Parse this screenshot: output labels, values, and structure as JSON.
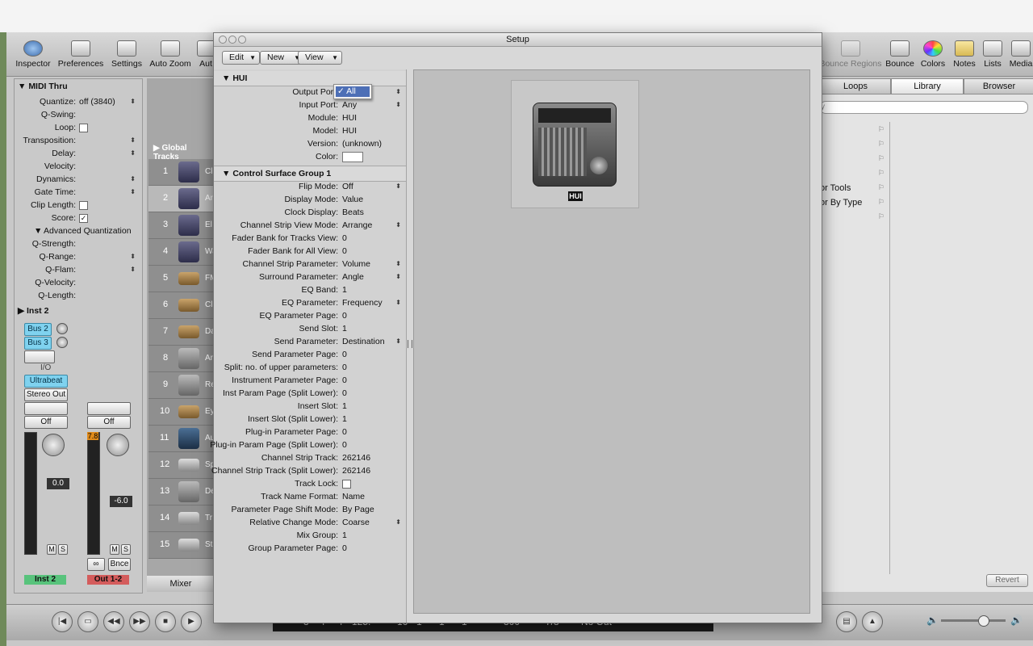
{
  "toolbar": {
    "items": [
      {
        "label": "Inspector"
      },
      {
        "label": "Preferences"
      },
      {
        "label": "Settings"
      },
      {
        "label": "Auto Zoom"
      },
      {
        "label": "Aut"
      },
      {
        "label": "Bounce Regions"
      },
      {
        "label": "Bounce"
      },
      {
        "label": "Colors"
      },
      {
        "label": "Notes"
      },
      {
        "label": "Lists"
      },
      {
        "label": "Media"
      }
    ]
  },
  "inspector": {
    "region_header": "MIDI Thru",
    "rows": [
      {
        "label": "Quantize:",
        "value": "off (3840)"
      },
      {
        "label": "Q-Swing:",
        "value": ""
      },
      {
        "label": "Loop:",
        "value": ""
      },
      {
        "label": "Transposition:",
        "value": ""
      },
      {
        "label": "Delay:",
        "value": ""
      },
      {
        "label": "Velocity:",
        "value": ""
      },
      {
        "label": "Dynamics:",
        "value": ""
      },
      {
        "label": "Gate Time:",
        "value": ""
      },
      {
        "label": "Clip Length:",
        "value": ""
      },
      {
        "label": "Score:",
        "value": ""
      }
    ],
    "advanced_header": "Advanced Quantization",
    "adv_rows": [
      {
        "label": "Q-Strength:"
      },
      {
        "label": "Q-Range:"
      },
      {
        "label": "Q-Flam:"
      },
      {
        "label": "Q-Velocity:"
      },
      {
        "label": "Q-Length:"
      }
    ],
    "track_header": "Inst 2",
    "strip": {
      "sends": [
        "Bus 2",
        "Bus 3"
      ],
      "io_label": "I/O",
      "input": "Ultrabeat",
      "output": "Stereo Out",
      "auto_left": "Off",
      "auto_right": "Off",
      "peak_right": "7.8",
      "vol_left": "0.0",
      "vol_right": "-6.0",
      "mute": "M",
      "solo": "S",
      "bounce": "Bnce",
      "name_left": "Inst 2",
      "name_right": "Out 1-2"
    }
  },
  "tracks": {
    "global_label": "Global Tracks",
    "numbers": [
      "1",
      "2",
      "3",
      "4",
      "5",
      "6",
      "7",
      "8",
      "9",
      "10",
      "11",
      "12",
      "13",
      "14",
      "15"
    ],
    "name_fragments": [
      "Cl",
      "Ar",
      "El",
      "Wa",
      "FM",
      "Cl",
      "Da",
      "Ar",
      "Re",
      "Ey",
      "Au",
      "Sp",
      "De",
      "Tr",
      "St"
    ],
    "bottom_tab": "Mixer"
  },
  "right_panel": {
    "tabs": [
      "Loops",
      "Library",
      "Browser"
    ],
    "search_fragment": "y",
    "items": [
      "or Tools",
      "or By Type"
    ],
    "revert": "Revert"
  },
  "transport": {
    "lcd": [
      "3",
      "4",
      "4",
      "125.",
      "16",
      "1",
      "1",
      "1",
      "300",
      "7/8",
      "No Out"
    ]
  },
  "setup": {
    "title": "Setup",
    "menus": [
      "Edit",
      "New",
      "View"
    ],
    "device_section": "HUI",
    "device_rows": [
      {
        "label": "Output Port:",
        "value": "",
        "updown": true
      },
      {
        "label": "Input Port:",
        "value": "Any",
        "updown": true
      },
      {
        "label": "Module:",
        "value": "HUI",
        "updown": false
      },
      {
        "label": "Model:",
        "value": "HUI",
        "updown": false
      },
      {
        "label": "Version:",
        "value": "(unknown)",
        "updown": false
      },
      {
        "label": "Color:",
        "value": "",
        "updown": false
      }
    ],
    "group_section": "Control Surface Group 1",
    "group_rows": [
      {
        "label": "Flip Mode:",
        "value": "Off",
        "updown": true
      },
      {
        "label": "Display Mode:",
        "value": "Value",
        "updown": false
      },
      {
        "label": "Clock Display:",
        "value": "Beats",
        "updown": false
      },
      {
        "label": "Channel Strip View Mode:",
        "value": "Arrange",
        "updown": true
      },
      {
        "label": "Fader Bank for Tracks View:",
        "value": "0",
        "updown": false
      },
      {
        "label": "Fader Bank for All View:",
        "value": "0",
        "updown": false
      },
      {
        "label": "Channel Strip Parameter:",
        "value": "Volume",
        "updown": true
      },
      {
        "label": "Surround Parameter:",
        "value": "Angle",
        "updown": true
      },
      {
        "label": "EQ Band:",
        "value": "1",
        "updown": false
      },
      {
        "label": "EQ Parameter:",
        "value": "Frequency",
        "updown": true
      },
      {
        "label": "EQ Parameter Page:",
        "value": "0",
        "updown": false
      },
      {
        "label": "Send Slot:",
        "value": "1",
        "updown": false
      },
      {
        "label": "Send Parameter:",
        "value": "Destination",
        "updown": true
      },
      {
        "label": "Send Parameter Page:",
        "value": "0",
        "updown": false
      },
      {
        "label": "Split: no. of upper parameters:",
        "value": "0",
        "updown": false
      },
      {
        "label": "Instrument Parameter Page:",
        "value": "0",
        "updown": false
      },
      {
        "label": "Inst Param Page (Split Lower):",
        "value": "0",
        "updown": false
      },
      {
        "label": "Insert Slot:",
        "value": "1",
        "updown": false
      },
      {
        "label": "Insert Slot (Split Lower):",
        "value": "1",
        "updown": false
      },
      {
        "label": "Plug-in Parameter Page:",
        "value": "0",
        "updown": false
      },
      {
        "label": "Plug-in Param Page (Split Lower):",
        "value": "0",
        "updown": false
      },
      {
        "label": "Channel Strip Track:",
        "value": "262146",
        "updown": false
      },
      {
        "label": "Channel Strip Track (Split Lower):",
        "value": "262146",
        "updown": false
      },
      {
        "label": "Track Lock:",
        "value": "",
        "updown": false
      },
      {
        "label": "Track Name Format:",
        "value": "Name",
        "updown": false
      },
      {
        "label": "Parameter Page Shift Mode:",
        "value": "By Page",
        "updown": false
      },
      {
        "label": "Relative Change Mode:",
        "value": "Coarse",
        "updown": true
      },
      {
        "label": "Mix Group:",
        "value": "1",
        "updown": false
      },
      {
        "label": "Group Parameter Page:",
        "value": "0",
        "updown": false
      }
    ],
    "popup_option": "All",
    "popup_check": "✓",
    "device_label": "HUI"
  },
  "colors": {
    "accent": "#7fd2ef",
    "selection": "#4d6fb6",
    "inst_label": "#58c37c",
    "out_label": "#d45c5c"
  }
}
